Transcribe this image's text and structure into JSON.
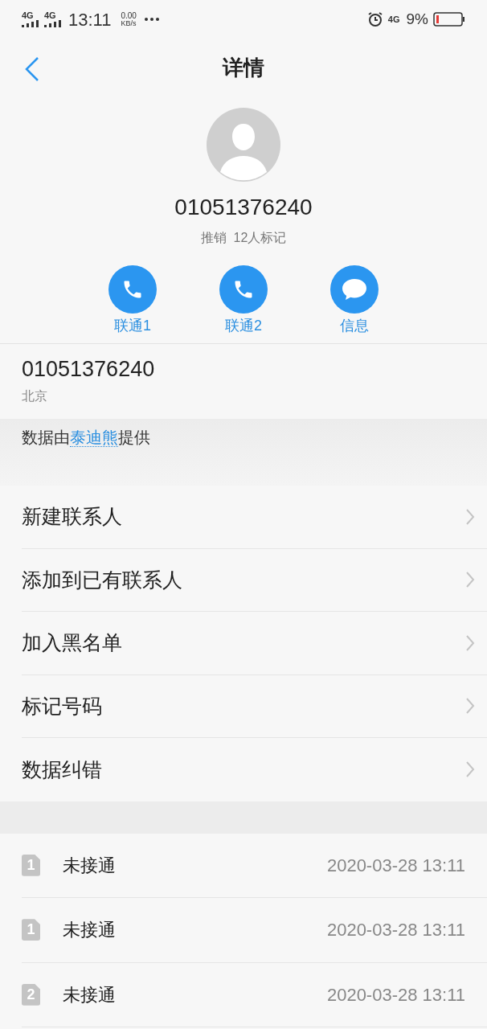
{
  "status_bar": {
    "sim_1": "4G",
    "sim_2": "4G",
    "time": "13:11",
    "speed_value": "0.00",
    "speed_unit": "KB/s",
    "network": "4G",
    "battery": "9%"
  },
  "header": {
    "title": "详情"
  },
  "contact": {
    "number": "01051376240",
    "tag": "推销  12人标记"
  },
  "actions": [
    {
      "kind": "call",
      "label": "联通1"
    },
    {
      "kind": "call",
      "label": "联通2"
    },
    {
      "kind": "message",
      "label": "信息"
    }
  ],
  "number_info": {
    "number": "01051376240",
    "location": "北京"
  },
  "data_source": {
    "prefix": "数据由",
    "link": "泰迪熊",
    "suffix": "提供"
  },
  "menu": [
    "新建联系人",
    "添加到已有联系人",
    "加入黑名单",
    "标记号码",
    "数据纠错"
  ],
  "calls": [
    {
      "sim": "1",
      "status": "未接通",
      "time": "2020-03-28 13:11"
    },
    {
      "sim": "1",
      "status": "未接通",
      "time": "2020-03-28 13:11"
    },
    {
      "sim": "2",
      "status": "未接通",
      "time": "2020-03-28 13:11"
    }
  ]
}
